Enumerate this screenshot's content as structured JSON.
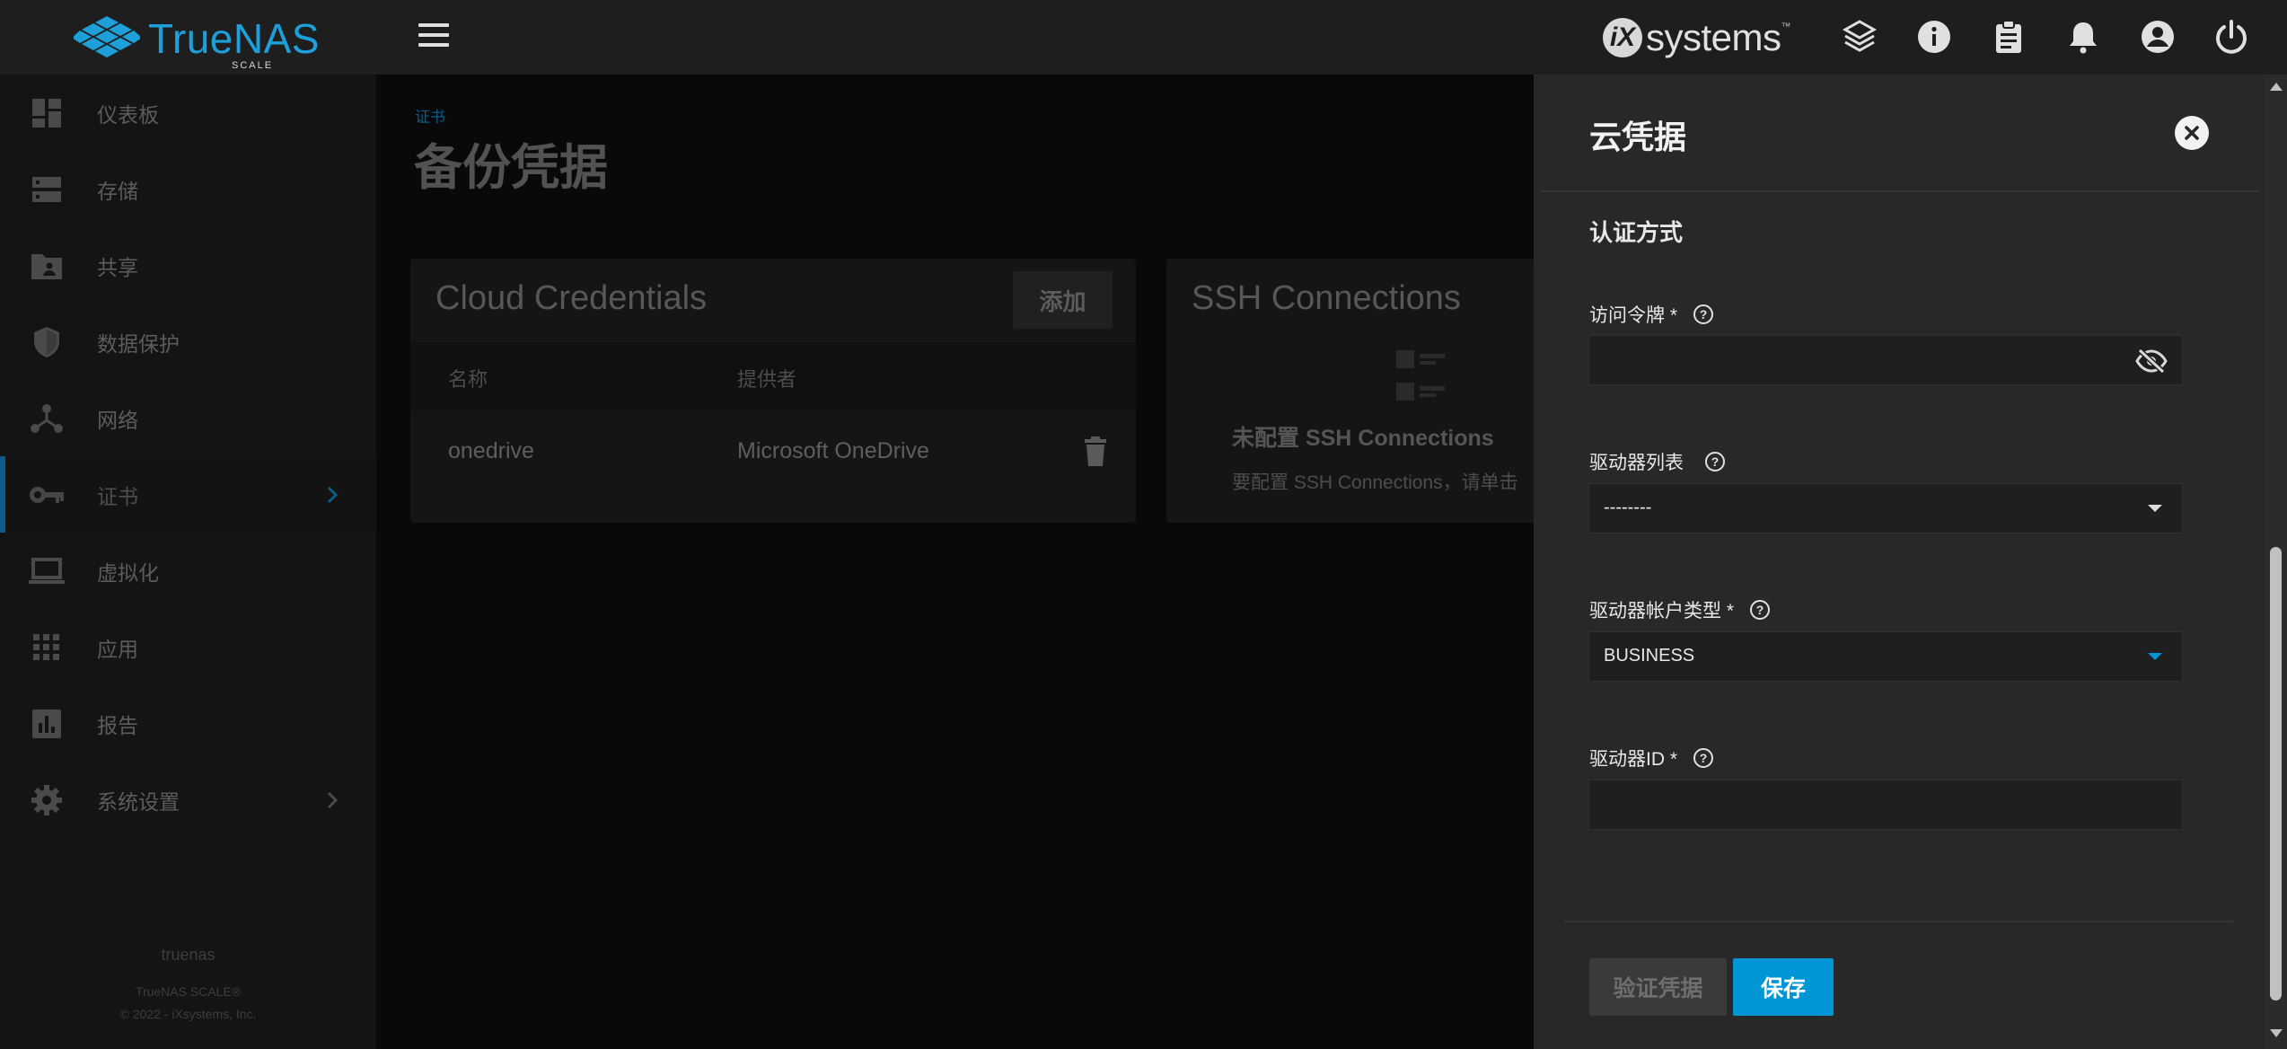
{
  "app": {
    "logo_text": "TrueNAS",
    "logo_sub": "SCALE",
    "vendor": "systems",
    "vendor_mark": "iX"
  },
  "topbar_icons": [
    "truecommand-icon",
    "info-icon",
    "clipboard-icon",
    "bell-icon",
    "account-icon",
    "power-icon"
  ],
  "sidebar": {
    "items": [
      {
        "label": "仪表板",
        "icon": "dashboard-icon"
      },
      {
        "label": "存储",
        "icon": "storage-icon"
      },
      {
        "label": "共享",
        "icon": "folder-share-icon"
      },
      {
        "label": "数据保护",
        "icon": "shield-icon"
      },
      {
        "label": "网络",
        "icon": "network-icon"
      },
      {
        "label": "证书",
        "icon": "key-icon",
        "active": true
      },
      {
        "label": "虚拟化",
        "icon": "laptop-icon"
      },
      {
        "label": "应用",
        "icon": "apps-grid-icon"
      },
      {
        "label": "报告",
        "icon": "chart-icon"
      },
      {
        "label": "系统设置",
        "icon": "gear-icon"
      }
    ],
    "hostname": "truenas",
    "footer_product": "TrueNAS SCALE®",
    "footer_copyright": "© 2022 - iXsystems, Inc."
  },
  "page": {
    "breadcrumb": "证书",
    "title": "备份凭据",
    "cloud_card": {
      "title": "Cloud Credentials",
      "add_label": "添加",
      "columns": [
        "名称",
        "提供者"
      ],
      "rows": [
        {
          "name": "onedrive",
          "provider": "Microsoft OneDrive"
        }
      ]
    },
    "ssh_card": {
      "title": "SSH Connections",
      "empty_title": "未配置 SSH Connections",
      "empty_text": "要配置 SSH Connections，请单击"
    }
  },
  "panel": {
    "title": "云凭据",
    "section_title": "认证方式",
    "fields": {
      "access_token": {
        "label": "访问令牌 *",
        "value": ""
      },
      "drives_list": {
        "label": "驱动器列表",
        "value": "--------"
      },
      "drive_account_type": {
        "label": "驱动器帐户类型 *",
        "value": "BUSINESS"
      },
      "drive_id": {
        "label": "驱动器ID *",
        "value": ""
      }
    },
    "verify_label": "验证凭据",
    "save_label": "保存"
  },
  "colors": {
    "accent": "#0095d5",
    "brand": "#1d9fd9",
    "panel_bg": "#282828"
  }
}
